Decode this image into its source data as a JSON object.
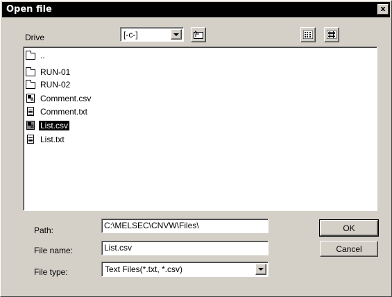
{
  "window": {
    "title": "Open file",
    "close_glyph": "x"
  },
  "drive": {
    "label": "Drive",
    "value": "[-c-]"
  },
  "files": [
    {
      "name": "..",
      "type": "folder",
      "selected": false
    },
    {
      "name": "RUN-01",
      "type": "folder",
      "selected": false
    },
    {
      "name": "RUN-02",
      "type": "folder",
      "selected": false
    },
    {
      "name": "Comment.csv",
      "type": "csv",
      "selected": false
    },
    {
      "name": "Comment.txt",
      "type": "txt",
      "selected": false
    },
    {
      "name": "List.csv",
      "type": "csv",
      "selected": true
    },
    {
      "name": "List.txt",
      "type": "txt",
      "selected": false
    }
  ],
  "path": {
    "label": "Path:",
    "value": "C:\\MELSEC\\CNVW\\Files\\"
  },
  "filename": {
    "label": "File name:",
    "value": "List.csv"
  },
  "filetype": {
    "label": "File type:",
    "value": "Text Files(*.txt, *.csv)"
  },
  "buttons": {
    "ok": "OK",
    "cancel": "Cancel"
  }
}
